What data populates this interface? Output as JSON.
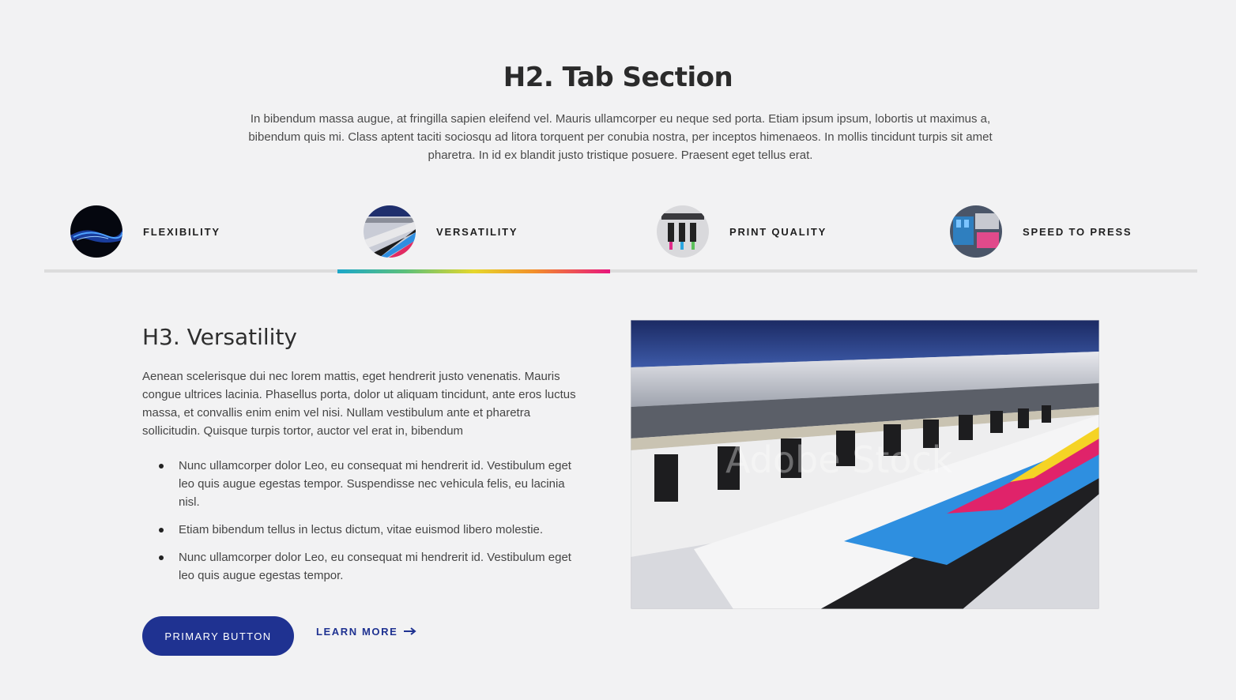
{
  "section": {
    "title": "H2. Tab Section",
    "intro": "In bibendum massa augue, at fringilla sapien eleifend vel. Mauris ullamcorper eu neque sed porta. Etiam ipsum ipsum, lobortis ut maximus a, bibendum quis mi. Class aptent taciti sociosqu ad litora torquent per conubia nostra, per inceptos himenaeos. In mollis tincidunt turpis sit amet pharetra. In id ex blandit justo tristique posuere. Praesent eget tellus erat."
  },
  "tabs": [
    {
      "label": "FLEXIBILITY",
      "icon": "flexibility-thumbnail"
    },
    {
      "label": "VERSATILITY",
      "icon": "versatility-thumbnail",
      "active": true
    },
    {
      "label": "PRINT QUALITY",
      "icon": "print-quality-thumbnail"
    },
    {
      "label": "SPEED TO PRESS",
      "icon": "speed-to-press-thumbnail"
    }
  ],
  "active_tab": 1,
  "indicator_colors": [
    "#1ca7c9",
    "#5cc07a",
    "#e6d72b",
    "#f2902a",
    "#e8177d"
  ],
  "content": {
    "title": "H3. Versatility",
    "body": "Aenean scelerisque dui nec lorem mattis, eget hendrerit justo venenatis. Mauris congue ultrices lacinia. Phasellus porta, dolor ut aliquam tincidunt, ante eros luctus massa, et convallis enim enim vel nisi. Nullam vestibulum ante et pharetra sollicitudin. Quisque turpis tortor, auctor vel erat in, bibendum",
    "bullets": [
      "Nunc ullamcorper dolor Leo, eu consequat mi hendrerit id. Vestibulum eget leo quis augue egestas tempor. Suspendisse nec vehicula felis, eu lacinia nisl.",
      "Etiam bibendum tellus in lectus dictum, vitae euismod libero molestie.",
      "Nunc ullamcorper dolor Leo, eu consequat mi hendrerit id. Vestibulum eget leo quis augue egestas tempor."
    ],
    "primary_button": "PRIMARY BUTTON",
    "learn_more": "LEARN MORE",
    "image_watermark": "Adobe Stock"
  },
  "colors": {
    "primary": "#1f3291",
    "background": "#f2f2f3"
  }
}
